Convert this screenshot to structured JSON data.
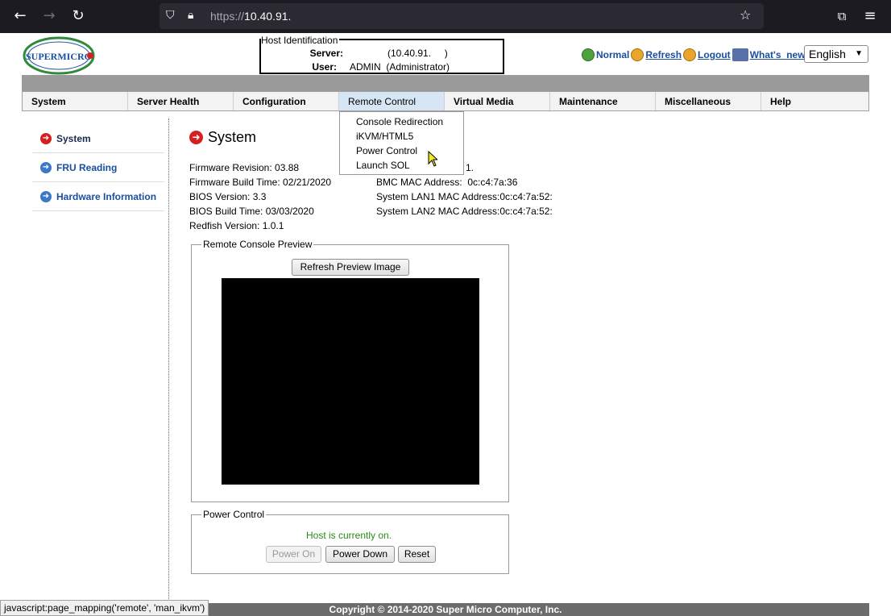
{
  "browser": {
    "url_protocol": "https://",
    "url_host": "10.40.91.",
    "status_tip": "javascript:page_mapping('remote', 'man_ikvm')"
  },
  "logo": {
    "text": "SUPERMICRO"
  },
  "host": {
    "legend": "Host Identification",
    "server_label": "Server:",
    "server_value": "(10.40.91.     )",
    "user_label": "User:",
    "user_value": "ADMIN  (Administrator)"
  },
  "top_links": {
    "normal": "Normal",
    "refresh": "Refresh",
    "logout": "Logout",
    "whats_new": "What's_new",
    "language": "English"
  },
  "menu": {
    "items": [
      "System",
      "Server Health",
      "Configuration",
      "Remote Control",
      "Virtual Media",
      "Maintenance",
      "Miscellaneous",
      "Help"
    ],
    "active": "Remote Control"
  },
  "dropdown": {
    "items": [
      "Console Redirection",
      "iKVM/HTML5",
      "Power Control",
      "Launch SOL"
    ]
  },
  "sidebar": {
    "items": [
      "System",
      "FRU Reading",
      "Hardware Information"
    ]
  },
  "main": {
    "title": "System",
    "firmware_revision": "Firmware Revision: 03.88",
    "firmware_build_time": "Firmware Build Time: 02/21/2020",
    "bios_version": "BIOS Version: 3.3",
    "bios_build_time": "BIOS Build Time: 03/03/2020",
    "redfish_version": "Redfish Version: 1.0.1",
    "ip_partial": "1.",
    "bmc_mac": "BMC MAC Address:  0c:c4:7a:36",
    "lan1_mac": "System LAN1 MAC Address:0c:c4:7a:52:",
    "lan2_mac": "System LAN2 MAC Address:0c:c4:7a:52:"
  },
  "preview": {
    "legend": "Remote Console Preview",
    "refresh_button": "Refresh Preview Image"
  },
  "power": {
    "legend": "Power Control",
    "status": "Host is currently on.",
    "power_on": "Power On",
    "power_down": "Power Down",
    "reset": "Reset"
  },
  "footer": {
    "copyright": "Copyright © 2014-2020 Super Micro Computer, Inc."
  }
}
